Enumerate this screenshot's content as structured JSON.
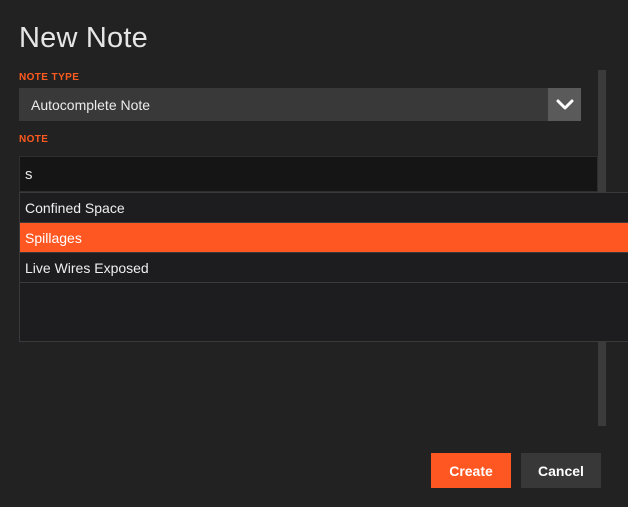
{
  "dialog": {
    "title": "New Note"
  },
  "note_type": {
    "label": "NOTE TYPE",
    "selected": "Autocomplete Note",
    "arrow_icon": "chevron-down-icon"
  },
  "note": {
    "label": "NOTE",
    "value": "s",
    "suggestions": [
      {
        "label": "Confined Space",
        "highlighted": false
      },
      {
        "label": "Spillages",
        "highlighted": true
      },
      {
        "label": "Live Wires Exposed",
        "highlighted": false
      }
    ]
  },
  "buttons": {
    "create_label": "Create",
    "cancel_label": "Cancel"
  },
  "colors": {
    "accent": "#ff5722",
    "background": "#222222",
    "select_bg": "#393939",
    "input_bg": "#151515"
  }
}
